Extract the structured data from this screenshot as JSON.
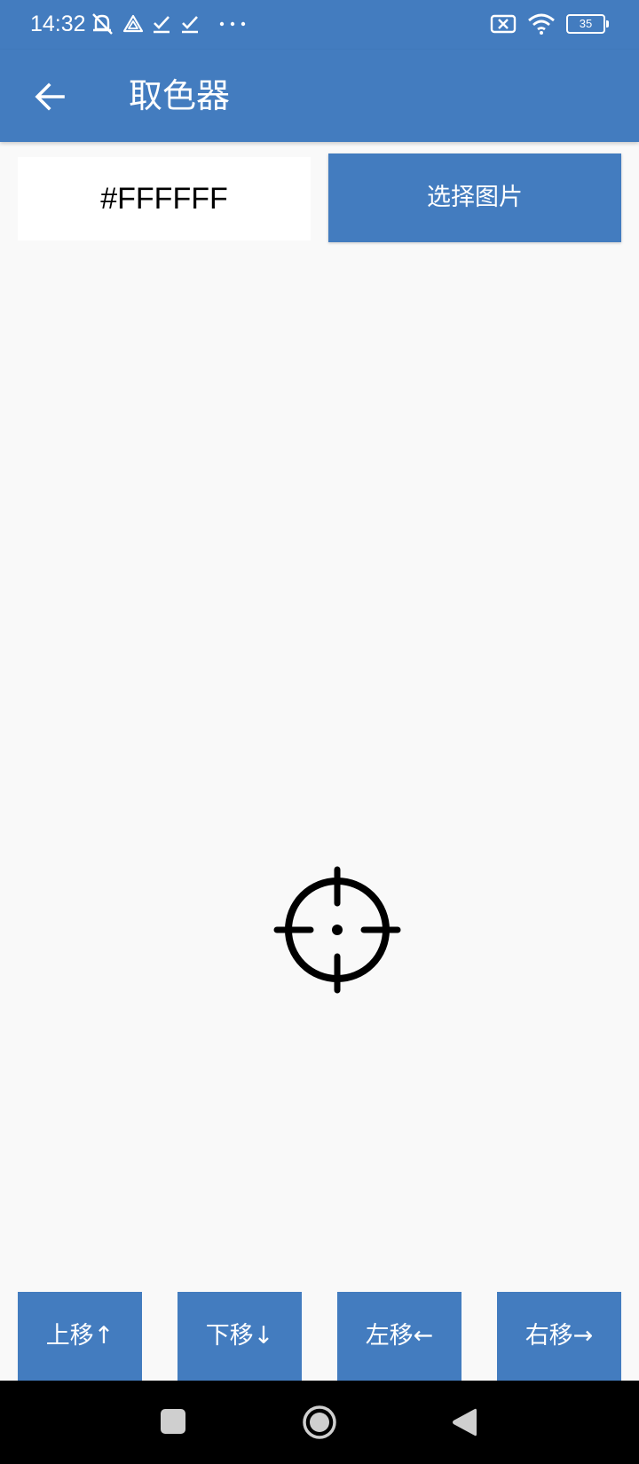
{
  "status_bar": {
    "time": "14:32",
    "battery": "35",
    "left_icons": [
      "muted-notification-icon",
      "triangle-app-icon",
      "check-icon",
      "check-icon",
      "more-dots-icon"
    ],
    "right_icons": [
      "sim-off-icon",
      "wifi-icon",
      "battery-icon"
    ]
  },
  "app_bar": {
    "title": "取色器",
    "back_icon": "arrow-left-icon"
  },
  "color_display": {
    "hex": "#FFFFFF"
  },
  "select_image_label": "选择图片",
  "crosshair_icon": "crosshair-icon",
  "move_buttons": {
    "up": "上移↑",
    "down": "下移↓",
    "left": "左移←",
    "right": "右移→"
  },
  "nav_bar": {
    "icons": [
      "recent-apps-icon",
      "home-icon",
      "back-triangle-icon"
    ]
  },
  "colors": {
    "primary": "#437cbf",
    "background": "#f9f9f9",
    "nav_background": "#000000"
  }
}
